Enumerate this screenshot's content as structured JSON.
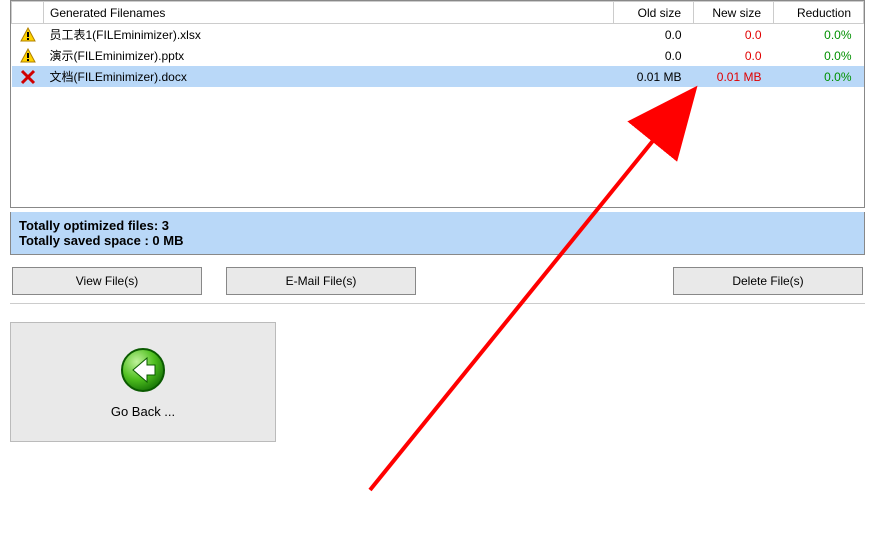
{
  "table": {
    "headers": {
      "icon": "",
      "filename": "Generated Filenames",
      "old_size": "Old size",
      "new_size": "New size",
      "reduction": "Reduction"
    },
    "rows": [
      {
        "icon": "warning",
        "filename": "员工表1(FILEminimizer).xlsx",
        "old_size": "0.0",
        "new_size": "0.0",
        "reduction": "0.0%",
        "selected": false
      },
      {
        "icon": "warning",
        "filename": "演示(FILEminimizer).pptx",
        "old_size": "0.0",
        "new_size": "0.0",
        "reduction": "0.0%",
        "selected": false
      },
      {
        "icon": "error",
        "filename": "文档(FILEminimizer).docx",
        "old_size": "0.01 MB",
        "new_size": "0.01 MB",
        "reduction": "0.0%",
        "selected": true
      }
    ]
  },
  "summary": {
    "line1": "Totally optimized files: 3",
    "line2": "Totally saved space  : 0 MB"
  },
  "buttons": {
    "view": "View File(s)",
    "email": "E-Mail File(s)",
    "delete": "Delete File(s)"
  },
  "goback": {
    "label": "Go Back ..."
  },
  "colors": {
    "accent_row": "#b9d8f8",
    "new_size": "#e00000",
    "reduction": "#009000"
  }
}
